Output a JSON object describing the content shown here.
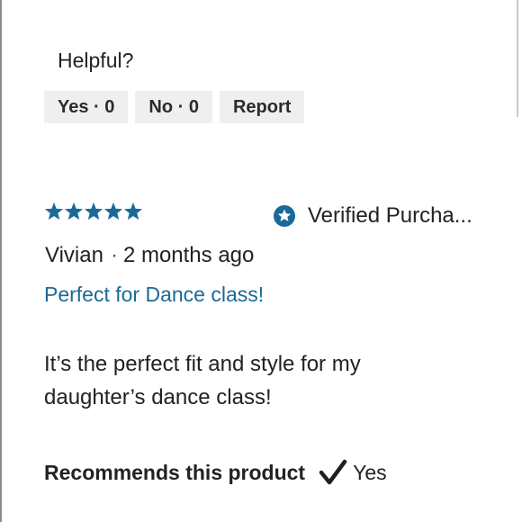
{
  "helpful": {
    "label": "Helpful?",
    "yes_label": "Yes · 0",
    "no_label": "No · 0",
    "report_label": "Report"
  },
  "review": {
    "rating": 5,
    "rating_max": 5,
    "star_color": "#1a6a98",
    "verified_text": "Verified Purcha...",
    "verified_icon": "star-badge-icon",
    "author": "Vivian",
    "separator": "·",
    "date": "2 months ago",
    "title": "Perfect for Dance class!",
    "title_color": "#1a6a98",
    "body": "It’s the perfect fit and style for my daughter’s dance class!",
    "recommends_label": "Recommends this product",
    "recommends_icon": "checkmark-icon",
    "recommends_value": "Yes"
  }
}
